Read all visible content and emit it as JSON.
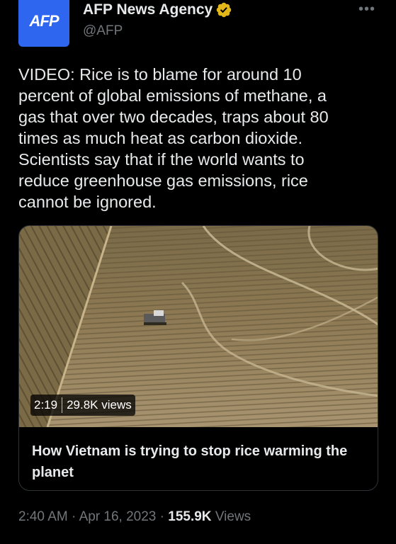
{
  "author": {
    "avatar_text": "AFP",
    "display_name": "AFP News Agency",
    "handle": "@AFP",
    "verified": true,
    "avatar_color": "#2f66f0",
    "badge_color": "#e2b719"
  },
  "menu": {
    "more_label": "•••"
  },
  "tweet": {
    "text": "VIDEO: Rice is to blame for around 10\npercent of global emissions of methane, a\ngas that over two decades, traps about 80\ntimes as much heat as carbon dioxide.\nScientists say that if the world wants to\nreduce greenhouse gas emissions, rice\ncannot be ignored."
  },
  "media": {
    "duration": "2:19",
    "views": "29.8K views",
    "title": "How Vietnam is trying to stop rice warming the planet"
  },
  "meta": {
    "time": "2:40 AM",
    "separator": " · ",
    "date": "Apr 16, 2023",
    "view_count": "155.9K",
    "views_label": " Views"
  }
}
